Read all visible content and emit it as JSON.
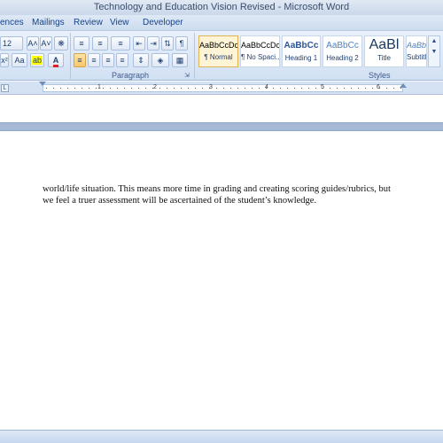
{
  "window": {
    "title": "Technology and Education Vision Revised - Microsoft Word"
  },
  "tabs": [
    {
      "label": "ences"
    },
    {
      "label": "Mailings"
    },
    {
      "label": "Review"
    },
    {
      "label": "View"
    },
    {
      "label": "Developer"
    }
  ],
  "font_group": {
    "font_size": "12",
    "grow_font": "A˄",
    "shrink_font": "A˅",
    "clear_format": "Aa"
  },
  "paragraph_group": {
    "label": "Paragraph",
    "show_marks": "¶"
  },
  "styles_group": {
    "label": "Styles",
    "items": [
      {
        "sample": "AaBbCcDc",
        "name": "¶ Normal",
        "selected": true
      },
      {
        "sample": "AaBbCcDc",
        "name": "¶ No Spaci..."
      },
      {
        "sample": "AaBbCc",
        "name": "Heading 1"
      },
      {
        "sample": "AaBbCc",
        "name": "Heading 2"
      },
      {
        "sample": "AaBl",
        "name": "Title"
      },
      {
        "sample": "AaBbCcI",
        "name": "Subtitle"
      }
    ]
  },
  "ruler": {
    "numbers": [
      "1",
      "2",
      "3",
      "4",
      "5",
      "6"
    ]
  },
  "document": {
    "lines": [
      "world/life situation.  This means more time in grading and creating scoring guides/rubrics, but",
      "we feel a truer assessment will be ascertained of the student’s knowledge."
    ]
  },
  "colors": {
    "ribbon": "#d1e0f3",
    "tab_text": "#15428b",
    "highlight": "#ffff00",
    "font_color": "#e02020"
  }
}
